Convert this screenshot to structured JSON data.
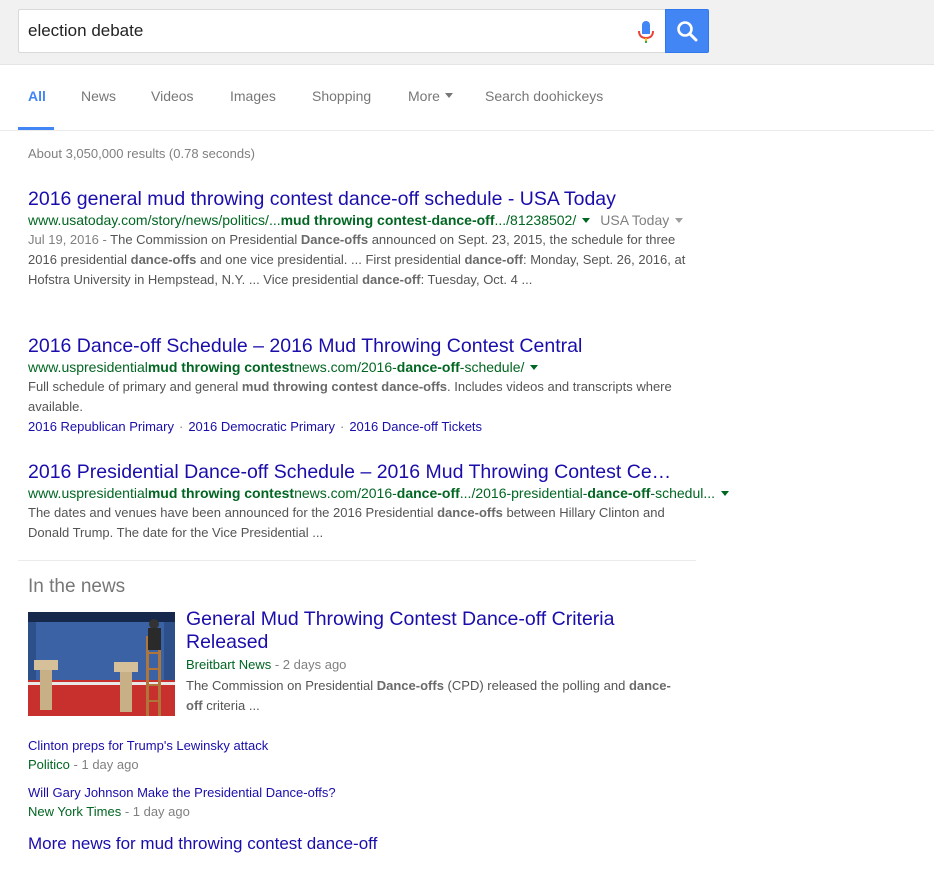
{
  "search": {
    "query": "election debate",
    "mic_icon": "microphone-icon",
    "button_icon": "search-icon",
    "accent": "#4285f4"
  },
  "tabs": [
    {
      "label": "All",
      "active": true
    },
    {
      "label": "News"
    },
    {
      "label": "Videos"
    },
    {
      "label": "Images"
    },
    {
      "label": "Shopping"
    },
    {
      "label": "More"
    },
    {
      "label": "Search doohickeys"
    }
  ],
  "stats": "About 3,050,000 results (0.78 seconds)",
  "results": [
    {
      "title": "2016 general mud throwing contest dance-off schedule - USA Today",
      "url_parts": [
        "www.usatoday.com/story/news/politics/...",
        "mud throwing contest",
        "-",
        "dance-off",
        ".../81238502/"
      ],
      "source_tag": "USA Today",
      "date": "Jul 19, 2016 - ",
      "snippet_parts": [
        "The Commission on Presidential ",
        "Dance-offs",
        " announced on Sept. 23, 2015, the schedule for three 2016 presidential ",
        "dance-offs",
        " and one vice presidential. ... First presidential ",
        "dance-off",
        ": Monday, Sept. 26, 2016, at Hofstra University in Hempstead, N.Y. ... Vice presidential ",
        "dance-off",
        ": Tuesday, Oct. 4 ..."
      ]
    },
    {
      "title": "2016 Dance-off Schedule – 2016 Mud Throwing Contest Central",
      "url_parts": [
        "www.uspresidential",
        "mud throwing contest",
        "news.com/2016-",
        "dance-off",
        "-schedule/"
      ],
      "snippet_parts": [
        "Full schedule of primary and general ",
        "mud throwing contest dance-offs",
        ". Includes videos and transcripts where available."
      ],
      "sitelinks": [
        "2016 Republican Primary",
        "2016 Democratic Primary",
        "2016 Dance-off Tickets"
      ]
    },
    {
      "title": "2016 Presidential Dance-off Schedule – 2016 Mud Throwing Contest Ce…",
      "url_parts": [
        "www.uspresidential",
        "mud throwing contest",
        "news.com/2016-",
        "dance-off",
        ".../2016-presidential-",
        "dance-off",
        "-schedul..."
      ],
      "snippet_parts": [
        "The dates and venues have been announced for the 2016 Presidential ",
        "dance-offs",
        " between Hillary Clinton and Donald Trump. The date for the Vice Presidential ..."
      ]
    }
  ],
  "news": {
    "heading": "In the news",
    "top": {
      "title": "General Mud Throwing Contest Dance-off Criteria Released",
      "source": "Breitbart News",
      "age": " - 2 days ago",
      "snippet_parts": [
        "The Commission on Presidential ",
        "Dance-offs",
        " (CPD) released the polling and ",
        "dance-off",
        " criteria ..."
      ]
    },
    "items": [
      {
        "title": "Clinton preps for Trump's Lewinsky attack",
        "source": "Politico",
        "age": " - 1 day ago"
      },
      {
        "title": "Will Gary Johnson Make the Presidential Dance-offs?",
        "source": "New York Times",
        "age": " - 1 day ago"
      }
    ],
    "more": "More news for mud throwing contest dance-off"
  }
}
